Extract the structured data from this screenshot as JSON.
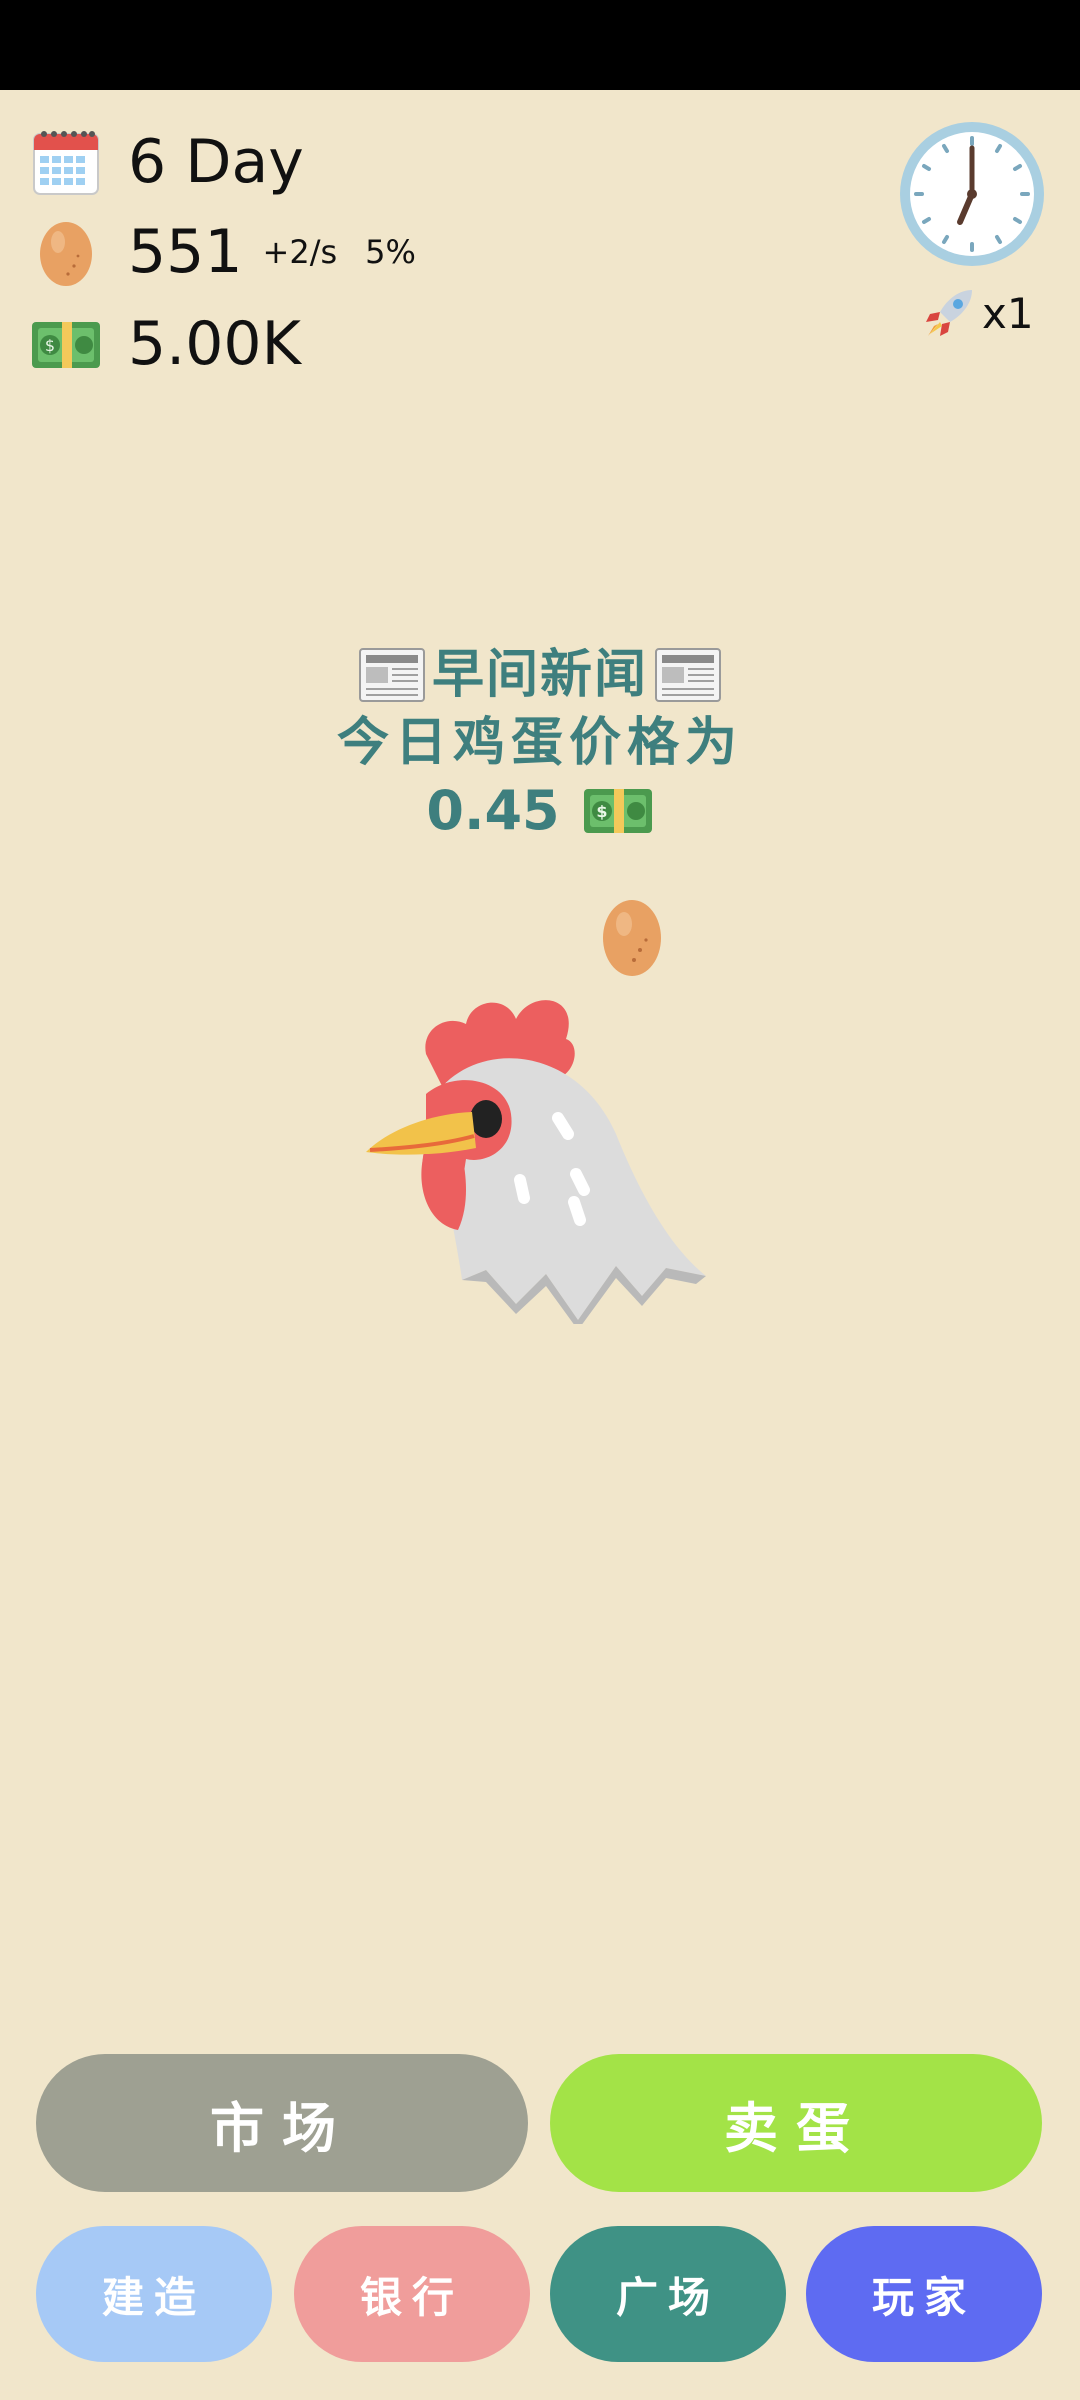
{
  "stats": {
    "day": "6 Day",
    "eggs": "551",
    "egg_rate": "+2/s",
    "egg_percent": "5%",
    "money": "5.00K"
  },
  "speed": {
    "label": "x1"
  },
  "news": {
    "title": "早间新闻",
    "subtitle": "今日鸡蛋价格为",
    "price": "0.45"
  },
  "buttons": {
    "market": "市场",
    "sell": "卖蛋",
    "build": "建造",
    "bank": "银行",
    "plaza": "广场",
    "player": "玩家"
  },
  "colors": {
    "background": "#f1e6cb",
    "news_text": "#3e7f7e",
    "market": "#9ea092",
    "sell": "#a3e347",
    "build": "#a6c9f6",
    "bank": "#f09d9b",
    "plaza": "#3f9285",
    "player": "#5e6bf2"
  },
  "icons": [
    "calendar-icon",
    "egg-icon",
    "money-icon",
    "clock-icon",
    "rocket-icon",
    "newspaper-icon",
    "chicken-icon"
  ]
}
